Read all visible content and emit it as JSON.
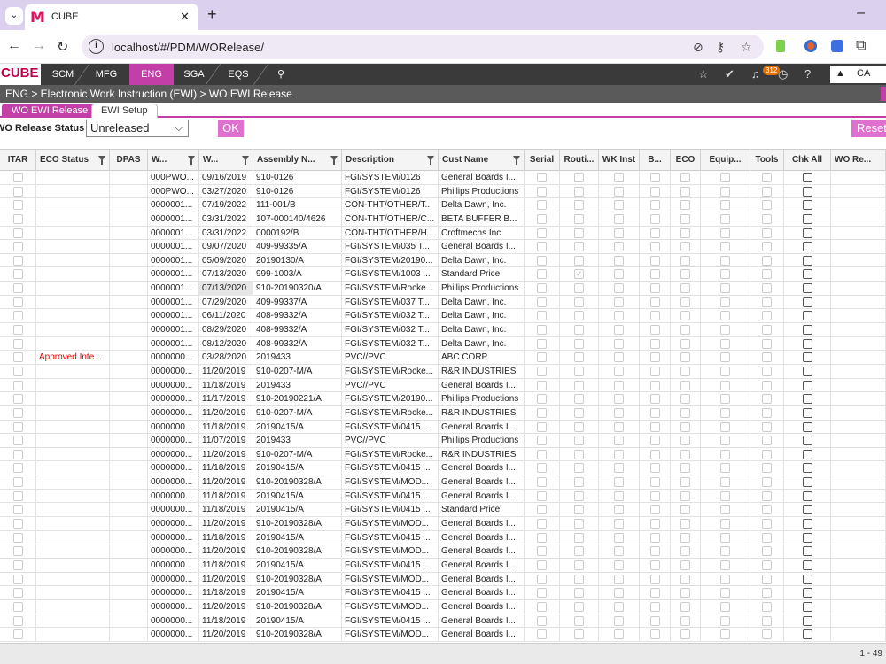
{
  "browser": {
    "tab_title": "CUBE",
    "tab_logo": "M",
    "url": "localhost/#/PDM/WORelease/"
  },
  "app": {
    "logo": "CUBE",
    "nav": [
      "SCM",
      "MFG",
      "ENG",
      "SGA",
      "EQS"
    ],
    "active_nav": "ENG",
    "notification_count": "312",
    "user": "CA",
    "help": "?"
  },
  "breadcrumb": "ENG > Electronic Work Instruction (EWI) > WO EWI Release",
  "subtabs": [
    "WO EWI Release",
    "EWI Setup"
  ],
  "filter": {
    "label": "WO Release Status",
    "value": "Unreleased",
    "ok_label": "OK",
    "reset_label": "Reset"
  },
  "columns": [
    "ITAR",
    "ECO Status",
    "DPAS",
    "W...",
    "W...",
    "Assembly N...",
    "Description",
    "Cust Name",
    "Serial",
    "Routi...",
    "WK Inst",
    "B...",
    "ECO",
    "Equip...",
    "Tools",
    "Chk All",
    "WO Re..."
  ],
  "rows": [
    {
      "eco": "",
      "wo": "000PWO...",
      "date": "09/16/2019",
      "asm": "910-0126",
      "desc": "FGI/SYSTEM/0126",
      "cust": "General Boards I...",
      "routing": false
    },
    {
      "eco": "",
      "wo": "000PWO...",
      "date": "03/27/2020",
      "asm": "910-0126",
      "desc": "FGI/SYSTEM/0126",
      "cust": "Phillips Productions",
      "routing": false
    },
    {
      "eco": "",
      "wo": "0000001...",
      "date": "07/19/2022",
      "asm": "111-001/B",
      "desc": "CON-THT/OTHER/T...",
      "cust": "Delta Dawn, Inc.",
      "routing": false
    },
    {
      "eco": "",
      "wo": "0000001...",
      "date": "03/31/2022",
      "asm": "107-000140/4626",
      "desc": "CON-THT/OTHER/C...",
      "cust": "BETA BUFFER B...",
      "routing": false
    },
    {
      "eco": "",
      "wo": "0000001...",
      "date": "03/31/2022",
      "asm": "0000192/B",
      "desc": "CON-THT/OTHER/H...",
      "cust": "Croftmechs Inc",
      "routing": false
    },
    {
      "eco": "",
      "wo": "0000001...",
      "date": "09/07/2020",
      "asm": "409-99335/A",
      "desc": "FGI/SYSTEM/035 T...",
      "cust": "General Boards I...",
      "routing": false
    },
    {
      "eco": "",
      "wo": "0000001...",
      "date": "05/09/2020",
      "asm": "20190130/A",
      "desc": "FGI/SYSTEM/20190...",
      "cust": "Delta Dawn, Inc.",
      "routing": false
    },
    {
      "eco": "",
      "wo": "0000001...",
      "date": "07/13/2020",
      "asm": "999-1003/A",
      "desc": "FGI/SYSTEM/1003 ...",
      "cust": "Standard Price",
      "routing": true
    },
    {
      "eco": "",
      "wo": "0000001...",
      "date": "07/13/2020",
      "asm": "910-20190320/A",
      "desc": "FGI/SYSTEM/Rocke...",
      "cust": "Phillips Productions",
      "routing": false,
      "hl": true
    },
    {
      "eco": "",
      "wo": "0000001...",
      "date": "07/29/2020",
      "asm": "409-99337/A",
      "desc": "FGI/SYSTEM/037 T...",
      "cust": "Delta Dawn, Inc.",
      "routing": false
    },
    {
      "eco": "",
      "wo": "0000001...",
      "date": "06/11/2020",
      "asm": "408-99332/A",
      "desc": "FGI/SYSTEM/032 T...",
      "cust": "Delta Dawn, Inc.",
      "routing": false
    },
    {
      "eco": "",
      "wo": "0000001...",
      "date": "08/29/2020",
      "asm": "408-99332/A",
      "desc": "FGI/SYSTEM/032 T...",
      "cust": "Delta Dawn, Inc.",
      "routing": false
    },
    {
      "eco": "",
      "wo": "0000001...",
      "date": "08/12/2020",
      "asm": "408-99332/A",
      "desc": "FGI/SYSTEM/032 T...",
      "cust": "Delta Dawn, Inc.",
      "routing": false
    },
    {
      "eco": "Approved Inte...",
      "wo": "0000000...",
      "date": "03/28/2020",
      "asm": "2019433",
      "desc": "PVC//PVC",
      "cust": "ABC CORP",
      "routing": false
    },
    {
      "eco": "",
      "wo": "0000000...",
      "date": "11/20/2019",
      "asm": "910-0207-M/A",
      "desc": "FGI/SYSTEM/Rocke...",
      "cust": "R&R INDUSTRIES",
      "routing": false
    },
    {
      "eco": "",
      "wo": "0000000...",
      "date": "11/18/2019",
      "asm": "2019433",
      "desc": "PVC//PVC",
      "cust": "General Boards I...",
      "routing": false
    },
    {
      "eco": "",
      "wo": "0000000...",
      "date": "11/17/2019",
      "asm": "910-20190221/A",
      "desc": "FGI/SYSTEM/20190...",
      "cust": "Phillips Productions",
      "routing": false
    },
    {
      "eco": "",
      "wo": "0000000...",
      "date": "11/20/2019",
      "asm": "910-0207-M/A",
      "desc": "FGI/SYSTEM/Rocke...",
      "cust": "R&R INDUSTRIES",
      "routing": false
    },
    {
      "eco": "",
      "wo": "0000000...",
      "date": "11/18/2019",
      "asm": "20190415/A",
      "desc": "FGI/SYSTEM/0415 ...",
      "cust": "General Boards I...",
      "routing": false
    },
    {
      "eco": "",
      "wo": "0000000...",
      "date": "11/07/2019",
      "asm": "2019433",
      "desc": "PVC//PVC",
      "cust": "Phillips Productions",
      "routing": false
    },
    {
      "eco": "",
      "wo": "0000000...",
      "date": "11/20/2019",
      "asm": "910-0207-M/A",
      "desc": "FGI/SYSTEM/Rocke...",
      "cust": "R&R INDUSTRIES",
      "routing": false
    },
    {
      "eco": "",
      "wo": "0000000...",
      "date": "11/18/2019",
      "asm": "20190415/A",
      "desc": "FGI/SYSTEM/0415 ...",
      "cust": "General Boards I...",
      "routing": false
    },
    {
      "eco": "",
      "wo": "0000000...",
      "date": "11/20/2019",
      "asm": "910-20190328/A",
      "desc": "FGI/SYSTEM/MOD...",
      "cust": "General Boards I...",
      "routing": false
    },
    {
      "eco": "",
      "wo": "0000000...",
      "date": "11/18/2019",
      "asm": "20190415/A",
      "desc": "FGI/SYSTEM/0415 ...",
      "cust": "General Boards I...",
      "routing": false
    },
    {
      "eco": "",
      "wo": "0000000...",
      "date": "11/18/2019",
      "asm": "20190415/A",
      "desc": "FGI/SYSTEM/0415 ...",
      "cust": "Standard Price",
      "routing": false
    },
    {
      "eco": "",
      "wo": "0000000...",
      "date": "11/20/2019",
      "asm": "910-20190328/A",
      "desc": "FGI/SYSTEM/MOD...",
      "cust": "General Boards I...",
      "routing": false
    },
    {
      "eco": "",
      "wo": "0000000...",
      "date": "11/18/2019",
      "asm": "20190415/A",
      "desc": "FGI/SYSTEM/0415 ...",
      "cust": "General Boards I...",
      "routing": false
    },
    {
      "eco": "",
      "wo": "0000000...",
      "date": "11/20/2019",
      "asm": "910-20190328/A",
      "desc": "FGI/SYSTEM/MOD...",
      "cust": "General Boards I...",
      "routing": false
    },
    {
      "eco": "",
      "wo": "0000000...",
      "date": "11/18/2019",
      "asm": "20190415/A",
      "desc": "FGI/SYSTEM/0415 ...",
      "cust": "General Boards I...",
      "routing": false
    },
    {
      "eco": "",
      "wo": "0000000...",
      "date": "11/20/2019",
      "asm": "910-20190328/A",
      "desc": "FGI/SYSTEM/MOD...",
      "cust": "General Boards I...",
      "routing": false
    },
    {
      "eco": "",
      "wo": "0000000...",
      "date": "11/18/2019",
      "asm": "20190415/A",
      "desc": "FGI/SYSTEM/0415 ...",
      "cust": "General Boards I...",
      "routing": false
    },
    {
      "eco": "",
      "wo": "0000000...",
      "date": "11/20/2019",
      "asm": "910-20190328/A",
      "desc": "FGI/SYSTEM/MOD...",
      "cust": "General Boards I...",
      "routing": false
    },
    {
      "eco": "",
      "wo": "0000000...",
      "date": "11/18/2019",
      "asm": "20190415/A",
      "desc": "FGI/SYSTEM/0415 ...",
      "cust": "General Boards I...",
      "routing": false
    },
    {
      "eco": "",
      "wo": "0000000...",
      "date": "11/20/2019",
      "asm": "910-20190328/A",
      "desc": "FGI/SYSTEM/MOD...",
      "cust": "General Boards I...",
      "routing": false
    }
  ],
  "pager": "1 - 49",
  "colors": {
    "accent": "#c43ea8",
    "button": "#e070d0",
    "header_dark": "#3a3a3a",
    "breadcrumb_bg": "#5a5a5a",
    "red_text": "#e00000"
  }
}
